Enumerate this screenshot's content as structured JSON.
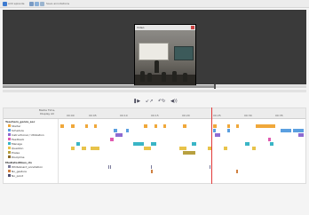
{
  "toolbar": {
    "items": [
      {
        "name": "add-icon",
        "color": "#3d7bd0"
      },
      {
        "name": "file-icon",
        "color": "#7a9bc4"
      },
      {
        "name": "save-icon",
        "color": "#8ab0d8"
      },
      {
        "name": "undo-icon",
        "color": "#9bb5cf"
      }
    ],
    "text_a": "Add episode",
    "text_b": "Save annotations"
  },
  "video": {
    "window_title": "Video"
  },
  "controls": [
    {
      "name": "play-pause-button",
      "glyph": "❚▶"
    },
    {
      "name": "step-buttons",
      "glyph": "↙↗"
    },
    {
      "name": "loop-button",
      "glyph": "↶↻"
    },
    {
      "name": "volume-button",
      "glyph": "◀))"
    }
  ],
  "timeline": {
    "ruler_label": "Media Time, Display All",
    "ticks": [
      "00:00",
      "00:05",
      "00:10",
      "00:15",
      "00:20",
      "00:25",
      "00:30",
      "00:35"
    ],
    "groups": [
      {
        "label": "Teachers_genre_sec",
        "tracks": [
          {
            "label": "Starter",
            "color": "#f0a83a"
          },
          {
            "label": "Schedule",
            "color": "#5a9fe0"
          },
          {
            "label": "Instructional / Utilization",
            "color": "#8e6bd1"
          },
          {
            "label": "Feedback",
            "color": "#e05ab0"
          },
          {
            "label": "Manage",
            "color": "#3ab5c6"
          },
          {
            "label": "Question",
            "color": "#e8c34a"
          },
          {
            "label": "Praise",
            "color": "#b8a040"
          },
          {
            "label": "Discipline",
            "color": "#8a6a2a"
          }
        ]
      },
      {
        "label": "Mediatedlines_cls",
        "tracks": [
          {
            "label": "Whiteboard_annotation",
            "color": "#7a7a9a"
          },
          {
            "label": "No_gesture",
            "color": "#d08040"
          },
          {
            "label": "No_point",
            "color": "#505070"
          }
        ]
      }
    ]
  }
}
